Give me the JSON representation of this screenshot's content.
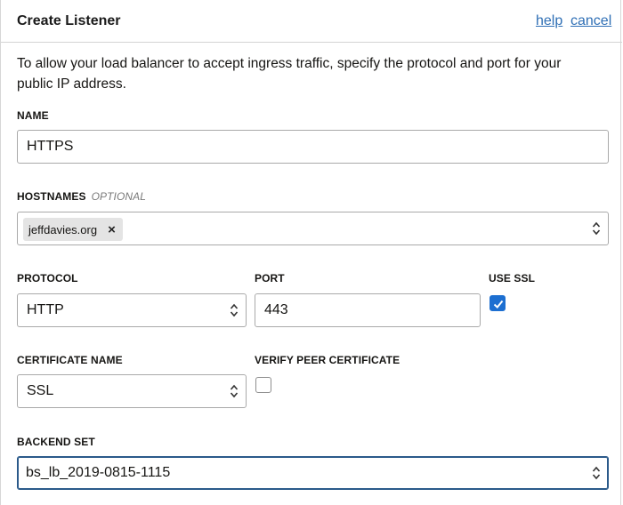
{
  "dialog": {
    "title": "Create Listener",
    "help_label": "help",
    "cancel_label": "cancel",
    "intro": "To allow your load balancer to accept ingress traffic, specify the protocol and port for your public IP address."
  },
  "name": {
    "label": "NAME",
    "value": "HTTPS"
  },
  "hostnames": {
    "label": "HOSTNAMES",
    "optional_label": "OPTIONAL",
    "chips": [
      {
        "label": "jeffdavies.org",
        "remove_icon": "×"
      }
    ]
  },
  "protocol": {
    "label": "PROTOCOL",
    "value": "HTTP"
  },
  "port": {
    "label": "PORT",
    "value": "443"
  },
  "use_ssl": {
    "label": "USE SSL",
    "checked": true
  },
  "certificate": {
    "label": "CERTIFICATE NAME",
    "value": "SSL"
  },
  "verify_peer": {
    "label": "VERIFY PEER CERTIFICATE",
    "checked": false
  },
  "backend_set": {
    "label": "BACKEND SET",
    "value": "bs_lb_2019-0815-1115"
  },
  "colors": {
    "link": "#2f6fb5",
    "checkbox_checked": "#1d6fd1",
    "focus_border": "#2b5a8a"
  },
  "icons": {
    "select_chevrons": "chevron-up-down-icon",
    "checkmark": "checkmark-icon",
    "chip_remove": "close-icon"
  }
}
